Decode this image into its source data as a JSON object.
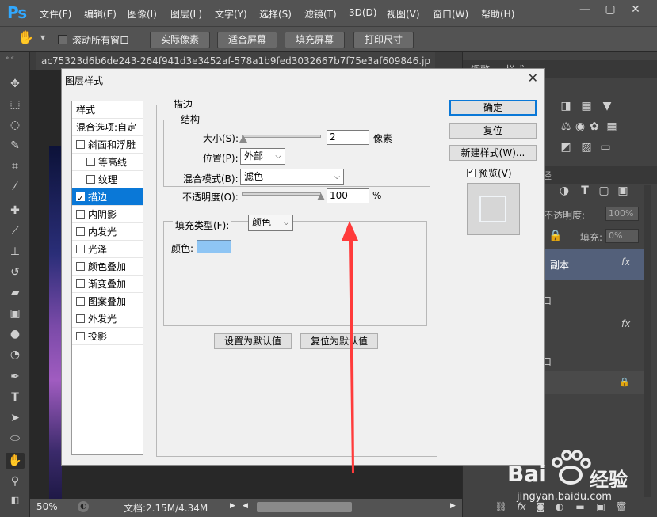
{
  "app": {
    "logo": "Ps"
  },
  "menu": [
    "文件(F)",
    "编辑(E)",
    "图像(I)",
    "图层(L)",
    "文字(Y)",
    "选择(S)",
    "滤镜(T)",
    "3D(D)",
    "视图(V)",
    "窗口(W)",
    "帮助(H)"
  ],
  "window_controls": {
    "minimize": "—",
    "restore": "▢",
    "close": "✕"
  },
  "options_bar": {
    "scroll_all_label": "滚动所有窗口",
    "buttons": [
      "实际像素",
      "适合屏幕",
      "填充屏幕",
      "打印尺寸"
    ]
  },
  "document": {
    "tab_name": "ac75323d6b6de243-264f941d3e3452af-578a1b9fed3032667b7f75e3af609846.jp"
  },
  "status": {
    "zoom": "50%",
    "doc_info": "文档:2.15M/4.34M"
  },
  "right_panel": {
    "tab_adjust": "调整",
    "tab_styles": "样式",
    "opacity_label": "不透明度:",
    "opacity_value": "100%",
    "fill_label": "填充:",
    "fill_value": "0%",
    "layer_copy_name": "副本",
    "fx": "fx",
    "partial_char_1": "口",
    "partial_char_2": "口",
    "partial_char_3": "径"
  },
  "dialog": {
    "title": "图层样式",
    "close": "✕",
    "styles_header": "样式",
    "blend_options": "混合选项:自定",
    "styles": [
      {
        "label": "斜面和浮雕",
        "checked": false,
        "indent": false
      },
      {
        "label": "等高线",
        "checked": false,
        "indent": true
      },
      {
        "label": "纹理",
        "checked": false,
        "indent": true
      },
      {
        "label": "描边",
        "checked": true,
        "indent": false
      },
      {
        "label": "内阴影",
        "checked": false,
        "indent": false
      },
      {
        "label": "内发光",
        "checked": false,
        "indent": false
      },
      {
        "label": "光泽",
        "checked": false,
        "indent": false
      },
      {
        "label": "颜色叠加",
        "checked": false,
        "indent": false
      },
      {
        "label": "渐变叠加",
        "checked": false,
        "indent": false
      },
      {
        "label": "图案叠加",
        "checked": false,
        "indent": false
      },
      {
        "label": "外发光",
        "checked": false,
        "indent": false
      },
      {
        "label": "投影",
        "checked": false,
        "indent": false
      }
    ],
    "stroke": {
      "section_title": "描边",
      "structure_title": "结构",
      "size_label": "大小(S):",
      "size_value": "2",
      "size_unit": "像素",
      "size_level": 0.02,
      "position_label": "位置(P):",
      "position_value": "外部",
      "blend_label": "混合模式(B):",
      "blend_value": "滤色",
      "opacity_label": "不透明度(O):",
      "opacity_value": "100",
      "opacity_unit": "%",
      "opacity_level": 1.0,
      "fill_type_label": "填充类型(F):",
      "fill_type_value": "颜色",
      "color_label": "颜色:",
      "color_value": "#8ec5f4",
      "set_default": "设置为默认值",
      "reset_default": "复位为默认值"
    },
    "buttons": {
      "ok": "确定",
      "reset": "复位",
      "new_style": "新建样式(W)...",
      "preview": "预览(V)"
    }
  },
  "watermark": {
    "brand": "Bai",
    "brand2": "经验",
    "url": "jingyan.baidu.com"
  },
  "colors": {
    "accent": "#0a78d7",
    "arrow": "#ff3b3b"
  }
}
